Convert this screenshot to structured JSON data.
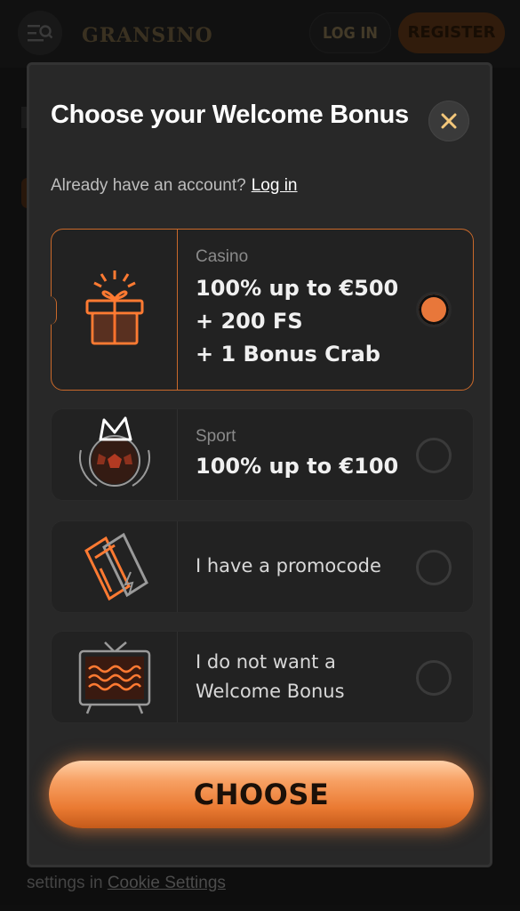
{
  "header": {
    "logo_text": "GRANSINO",
    "login_label": "LOG IN",
    "register_label": "REGISTER"
  },
  "background": {
    "footer_text": "settings in",
    "footer_link": "Cookie Settings"
  },
  "modal": {
    "title": "Choose your Welcome Bonus",
    "account_prompt": "Already have an account?",
    "login_link": "Log in",
    "options": [
      {
        "kind": "Casino",
        "offer_lines": [
          "100% up to €500",
          "+ 200 FS",
          "+ 1 Bonus Crab"
        ],
        "icon": "gift-icon",
        "selected": true
      },
      {
        "kind": "Sport",
        "offer_lines": [
          "100% up to €100"
        ],
        "icon": "crowned-ball-icon",
        "selected": false
      },
      {
        "text_lines": [
          "I have a promocode"
        ],
        "icon": "ticket-icon",
        "selected": false
      },
      {
        "text_lines": [
          "I do not want a",
          "Welcome Bonus"
        ],
        "icon": "tv-icon",
        "selected": false
      }
    ],
    "choose_label": "CHOOSE"
  },
  "colors": {
    "accent": "#e8773a",
    "modal_bg": "#282828",
    "card_bg": "#222222"
  }
}
